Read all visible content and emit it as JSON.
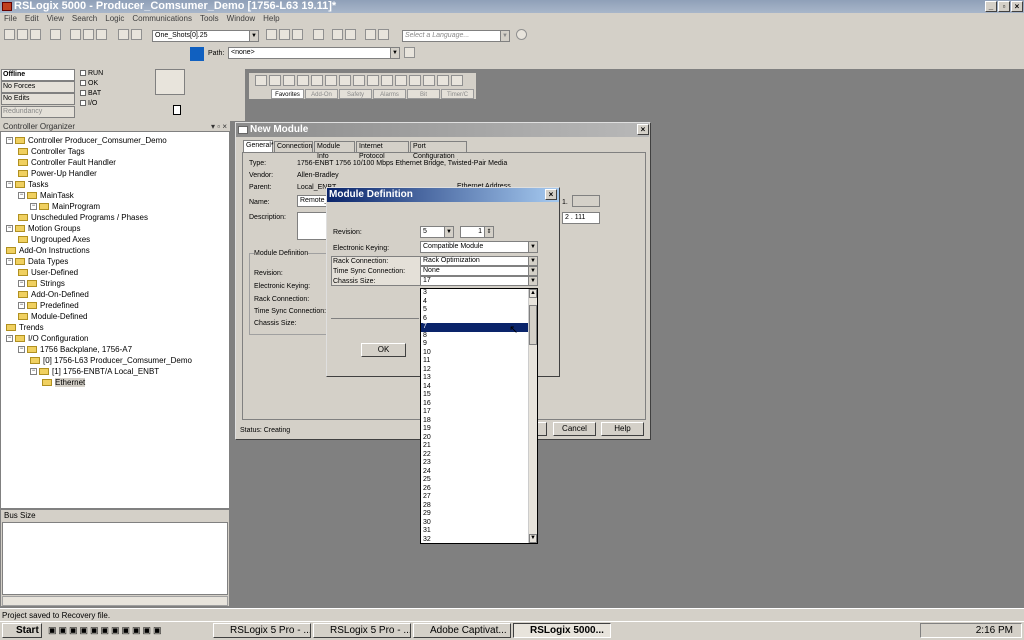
{
  "window": {
    "title": "RSLogix 5000 - Producer_Comsumer_Demo [1756-L63 19.11]*"
  },
  "menu": [
    "File",
    "Edit",
    "View",
    "Search",
    "Logic",
    "Communications",
    "Tools",
    "Window",
    "Help"
  ],
  "toolbar": {
    "tag_combo": "One_Shots[0].25",
    "language_placeholder": "Select a Language...",
    "path_label": "Path:",
    "path_value": "<none>"
  },
  "status": {
    "offline": "Offline",
    "forces": "No Forces",
    "edits": "No Edits",
    "redundancy": "Redundancy",
    "run": "RUN",
    "ok": "OK",
    "bat": "BAT",
    "io": "I/O"
  },
  "instr_tabs": [
    "Favorites",
    "Add-On",
    "Safety",
    "Alarms",
    "Bit",
    "Timer/C"
  ],
  "organizer": {
    "title": "Controller Organizer",
    "items": [
      "Controller Producer_Comsumer_Demo",
      "Controller Tags",
      "Controller Fault Handler",
      "Power-Up Handler",
      "Tasks",
      "MainTask",
      "MainProgram",
      "Unscheduled Programs / Phases",
      "Motion Groups",
      "Ungrouped Axes",
      "Add-On Instructions",
      "Data Types",
      "User-Defined",
      "Strings",
      "Add-On-Defined",
      "Predefined",
      "Module-Defined",
      "Trends",
      "I/O Configuration",
      "1756 Backplane, 1756-A7",
      "[0] 1756-L63 Producer_Comsumer_Demo",
      "[1] 1756-ENBT/A Local_ENBT",
      "Ethernet"
    ]
  },
  "bus_size": "Bus Size",
  "statusbar": "Project saved to Recovery file.",
  "taskbar": {
    "start": "Start",
    "tasks": [
      "RSLogix 5 Pro - ...",
      "RSLogix 5 Pro - ...",
      "Adobe Captivat...",
      "RSLogix 5000..."
    ],
    "clock": "2:16 PM"
  },
  "new_module": {
    "title": "New Module",
    "tabs": [
      "General*",
      "Connection",
      "Module Info",
      "Internet Protocol",
      "Port Configuration"
    ],
    "type_label": "Type:",
    "type_value": "1756-ENBT 1756 10/100 Mbps Ethernet Bridge, Twisted-Pair Media",
    "vendor_label": "Vendor:",
    "vendor_value": "Allen-Bradley",
    "parent_label": "Parent:",
    "parent_value": "Local_ENBT",
    "name_label": "Name:",
    "name_value": "Remote_",
    "desc_label": "Description:",
    "eth_label": "Ethernet Address",
    "ip_a": "1.",
    "ip_b": "2 . 111",
    "moddef_label": "Module Definition",
    "md_rows": [
      "Revision:",
      "Electronic Keying:",
      "Rack Connection:",
      "Time Sync Connection:",
      "Chassis Size:"
    ],
    "status_text": "Status: Creating",
    "cancel": "Cancel",
    "help": "Help"
  },
  "module_def": {
    "title": "Module Definition",
    "revision_label": "Revision:",
    "revision_major": "5",
    "revision_minor": "1",
    "keying_label": "Electronic Keying:",
    "keying_value": "Compatible Module",
    "rack_label": "Rack Connection:",
    "rack_value": "Rack Optimization",
    "sync_label": "Time Sync Connection:",
    "sync_value": "None",
    "chassis_label": "Chassis Size:",
    "chassis_value": "17",
    "ok": "OK",
    "options": [
      "3",
      "4",
      "5",
      "6",
      "7",
      "8",
      "9",
      "10",
      "11",
      "12",
      "13",
      "14",
      "15",
      "16",
      "17",
      "18",
      "19",
      "20",
      "21",
      "22",
      "23",
      "24",
      "25",
      "26",
      "27",
      "28",
      "29",
      "30",
      "31",
      "32"
    ],
    "selected_index": 4
  }
}
